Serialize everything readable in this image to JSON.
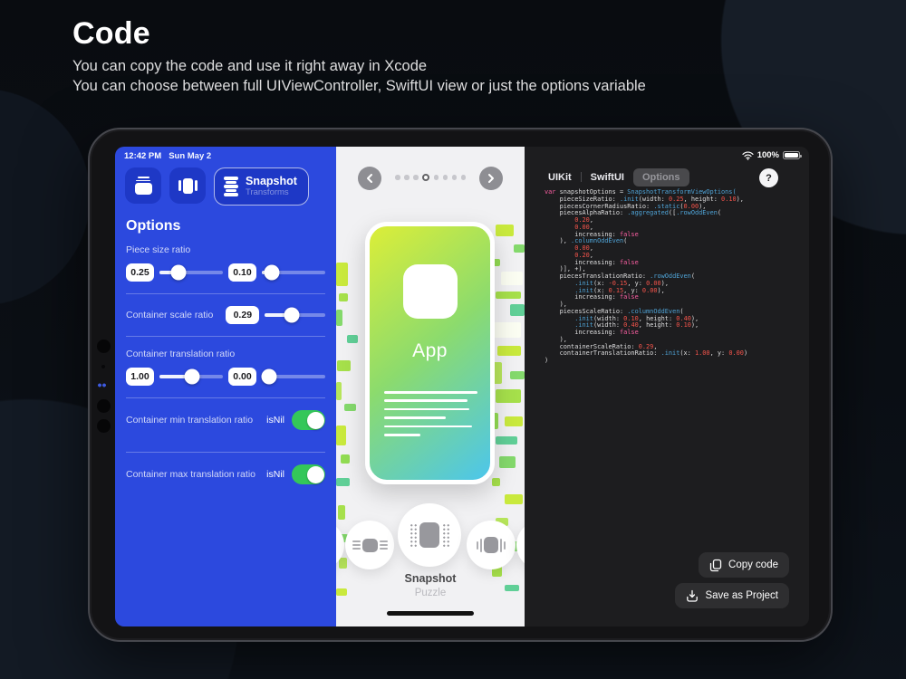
{
  "page": {
    "title": "Code",
    "subtitle1": "You can copy the code and use it right away in Xcode",
    "subtitle2": "You can choose between full UIViewController, SwiftUI view or just the options variable"
  },
  "statusbar": {
    "time": "12:42 PM",
    "date": "Sun May 2",
    "battery": "100%"
  },
  "sidebar": {
    "snapshot_button": {
      "title": "Snapshot",
      "subtitle": "Transforms"
    },
    "options_title": "Options",
    "groups": [
      {
        "type": "sliders",
        "label": "Piece size ratio",
        "sliders": [
          {
            "value": "0.25",
            "pct": 30
          },
          {
            "value": "0.10",
            "pct": 15
          }
        ]
      },
      {
        "type": "inline",
        "label": "Container scale ratio",
        "slider": {
          "value": "0.29",
          "pct": 45
        }
      },
      {
        "type": "sliders",
        "label": "Container translation ratio",
        "sliders": [
          {
            "value": "1.00",
            "pct": 52
          },
          {
            "value": "0.00",
            "pct": 12
          }
        ]
      },
      {
        "type": "toggle",
        "label": "Container min translation ratio",
        "value_label": "isNil",
        "on": true
      },
      {
        "type": "toggle",
        "label": "Container max translation ratio",
        "value_label": "isNil",
        "on": true
      }
    ]
  },
  "preview": {
    "carousel": {
      "dots": 8,
      "active_index": 3
    },
    "card_label": "App",
    "card_line_widths": [
      103,
      92,
      94,
      68,
      97,
      40
    ],
    "selector": {
      "title": "Snapshot",
      "subtitle": "Puzzle"
    },
    "piece_colors": [
      "#c9e93d",
      "#a6e04b",
      "#84d96c",
      "#60cf97",
      "#b7e55b",
      "#92dc53",
      "#6fd37f",
      "#fbfdf2"
    ],
    "pieces": [
      [
        0,
        128,
        13,
        26,
        0
      ],
      [
        3,
        162,
        10,
        9,
        1
      ],
      [
        0,
        180,
        7,
        18,
        2
      ],
      [
        12,
        208,
        12,
        9,
        3
      ],
      [
        1,
        236,
        15,
        12,
        1
      ],
      [
        0,
        260,
        6,
        20,
        4
      ],
      [
        9,
        284,
        13,
        8,
        2
      ],
      [
        0,
        308,
        11,
        22,
        0
      ],
      [
        5,
        340,
        10,
        10,
        5
      ],
      [
        0,
        366,
        15,
        9,
        3
      ],
      [
        2,
        396,
        8,
        16,
        1
      ],
      [
        0,
        428,
        13,
        9,
        2
      ],
      [
        3,
        454,
        9,
        12,
        4
      ],
      [
        0,
        488,
        12,
        8,
        0
      ],
      [
        176,
        86,
        20,
        13,
        0
      ],
      [
        196,
        108,
        12,
        9,
        2
      ],
      [
        172,
        124,
        9,
        8,
        5
      ],
      [
        182,
        138,
        24,
        15,
        7
      ],
      [
        176,
        160,
        28,
        8,
        1
      ],
      [
        192,
        174,
        16,
        13,
        3
      ],
      [
        172,
        194,
        32,
        17,
        7
      ],
      [
        178,
        220,
        26,
        11,
        0
      ],
      [
        172,
        238,
        11,
        24,
        4
      ],
      [
        192,
        248,
        16,
        9,
        2
      ],
      [
        176,
        268,
        28,
        15,
        1
      ],
      [
        172,
        294,
        7,
        18,
        5
      ],
      [
        186,
        298,
        20,
        11,
        0
      ],
      [
        176,
        320,
        24,
        9,
        3
      ],
      [
        180,
        342,
        18,
        13,
        2
      ],
      [
        172,
        366,
        9,
        9,
        1
      ],
      [
        186,
        384,
        20,
        11,
        0
      ],
      [
        176,
        410,
        14,
        9,
        4
      ],
      [
        182,
        436,
        22,
        11,
        2
      ],
      [
        172,
        460,
        11,
        15,
        1
      ],
      [
        186,
        484,
        16,
        7,
        3
      ],
      [
        150,
        98,
        10,
        8,
        2
      ],
      [
        158,
        118,
        8,
        12,
        1
      ]
    ]
  },
  "code_panel": {
    "tabs": [
      {
        "label": "UIKit",
        "selected": false
      },
      {
        "label": "SwiftUI",
        "selected": false
      },
      {
        "label": "Options",
        "selected": true
      }
    ],
    "help_label": "?",
    "copy_button": "Copy code",
    "save_button": "Save as Project",
    "lines": [
      [
        [
          "k",
          "var"
        ],
        [
          "p",
          " snapshotOptions = "
        ],
        [
          "t",
          "SnapshotTransformViewOptions("
        ]
      ],
      [
        [
          "p",
          "    pieceSizeRatio: "
        ],
        [
          "t",
          ".init"
        ],
        [
          "p",
          "(width: "
        ],
        [
          "n",
          "0.25"
        ],
        [
          "p",
          ", height: "
        ],
        [
          "n",
          "0.10"
        ],
        [
          "p",
          "),"
        ]
      ],
      [
        [
          "p",
          "    piecesCornerRadiusRatio: "
        ],
        [
          "t",
          ".static"
        ],
        [
          "p",
          "("
        ],
        [
          "n",
          "0.00"
        ],
        [
          "p",
          "),"
        ]
      ],
      [
        [
          "p",
          "    piecesAlphaRatio: "
        ],
        [
          "t",
          ".aggregated"
        ],
        [
          "p",
          "(["
        ],
        [
          "t",
          ".rowOddEven"
        ],
        [
          "p",
          "("
        ]
      ],
      [
        [
          "p",
          "        "
        ],
        [
          "n",
          "0.20"
        ],
        [
          "p",
          ","
        ]
      ],
      [
        [
          "p",
          "        "
        ],
        [
          "n",
          "0.00"
        ],
        [
          "p",
          ","
        ]
      ],
      [
        [
          "p",
          "        increasing: "
        ],
        [
          "k",
          "false"
        ]
      ],
      [
        [
          "p",
          "    ), "
        ],
        [
          "t",
          ".columnOddEven"
        ],
        [
          "p",
          "("
        ]
      ],
      [
        [
          "p",
          "        "
        ],
        [
          "n",
          "0.00"
        ],
        [
          "p",
          ","
        ]
      ],
      [
        [
          "p",
          "        "
        ],
        [
          "n",
          "0.20"
        ],
        [
          "p",
          ","
        ]
      ],
      [
        [
          "p",
          "        increasing: "
        ],
        [
          "k",
          "false"
        ]
      ],
      [
        [
          "p",
          "    )], +),"
        ]
      ],
      [
        [
          "p",
          "    piecesTranslationRatio: "
        ],
        [
          "t",
          ".rowOddEven"
        ],
        [
          "p",
          "("
        ]
      ],
      [
        [
          "p",
          "        "
        ],
        [
          "t",
          ".init"
        ],
        [
          "p",
          "(x: "
        ],
        [
          "n",
          "-0.15"
        ],
        [
          "p",
          ", y: "
        ],
        [
          "n",
          "0.00"
        ],
        [
          "p",
          "),"
        ]
      ],
      [
        [
          "p",
          "        "
        ],
        [
          "t",
          ".init"
        ],
        [
          "p",
          "(x: "
        ],
        [
          "n",
          "0.15"
        ],
        [
          "p",
          ", y: "
        ],
        [
          "n",
          "0.00"
        ],
        [
          "p",
          "),"
        ]
      ],
      [
        [
          "p",
          "        increasing: "
        ],
        [
          "k",
          "false"
        ]
      ],
      [
        [
          "p",
          "    ),"
        ]
      ],
      [
        [
          "p",
          "    piecesScaleRatio: "
        ],
        [
          "t",
          ".columnOddEven"
        ],
        [
          "p",
          "("
        ]
      ],
      [
        [
          "p",
          "        "
        ],
        [
          "t",
          ".init"
        ],
        [
          "p",
          "(width: "
        ],
        [
          "n",
          "0.10"
        ],
        [
          "p",
          ", height: "
        ],
        [
          "n",
          "0.40"
        ],
        [
          "p",
          "),"
        ]
      ],
      [
        [
          "p",
          "        "
        ],
        [
          "t",
          ".init"
        ],
        [
          "p",
          "(width: "
        ],
        [
          "n",
          "0.40"
        ],
        [
          "p",
          ", height: "
        ],
        [
          "n",
          "0.10"
        ],
        [
          "p",
          "),"
        ]
      ],
      [
        [
          "p",
          "        increasing: "
        ],
        [
          "k",
          "false"
        ]
      ],
      [
        [
          "p",
          "    ),"
        ]
      ],
      [
        [
          "p",
          "    containerScaleRatio: "
        ],
        [
          "n",
          "0.29"
        ],
        [
          "p",
          ","
        ]
      ],
      [
        [
          "p",
          "    containerTranslationRatio: "
        ],
        [
          "t",
          ".init"
        ],
        [
          "p",
          "(x: "
        ],
        [
          "n",
          "1.00"
        ],
        [
          "p",
          ", y: "
        ],
        [
          "n",
          "0.00"
        ],
        [
          "p",
          ")"
        ]
      ],
      [
        [
          "p",
          ")"
        ]
      ]
    ]
  }
}
